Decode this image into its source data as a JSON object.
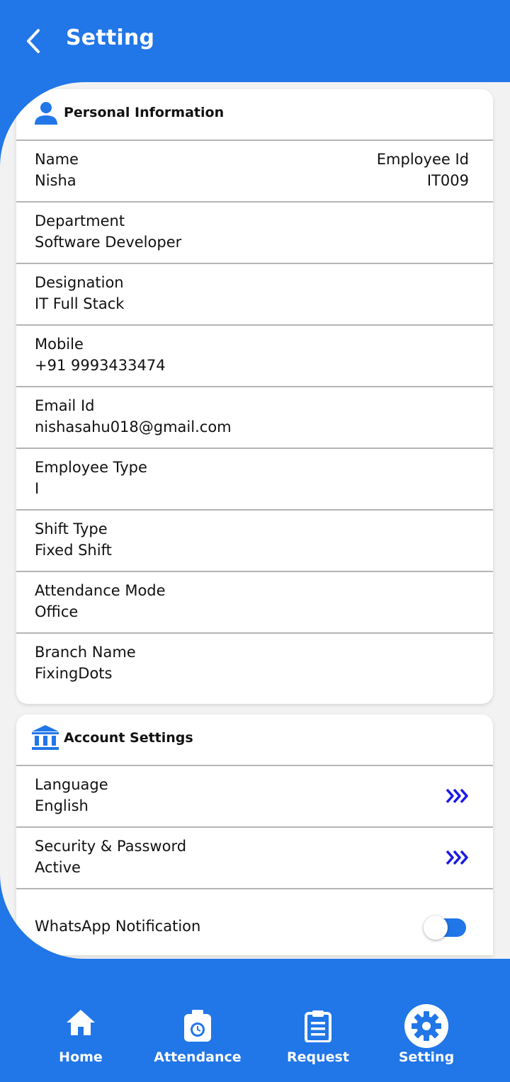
{
  "header": {
    "title": "Setting"
  },
  "personal": {
    "title": "Personal Information",
    "name_label": "Name",
    "name_value": "Nisha",
    "empid_label": "Employee Id",
    "empid_value": "IT009",
    "rows": [
      {
        "label": "Department",
        "value": "Software Developer"
      },
      {
        "label": "Designation",
        "value": "IT Full Stack"
      },
      {
        "label": "Mobile",
        "value": "+91 9993433474"
      },
      {
        "label": "Email Id",
        "value": "nishasahu018@gmail.com"
      },
      {
        "label": "Employee Type",
        "value": "I"
      },
      {
        "label": "Shift Type",
        "value": "Fixed Shift"
      },
      {
        "label": "Attendance Mode",
        "value": "Office"
      },
      {
        "label": "Branch Name",
        "value": "FixingDots"
      }
    ]
  },
  "account": {
    "title": "Account Settings",
    "rows": [
      {
        "label": "Language",
        "value": "English"
      },
      {
        "label": "Security & Password",
        "value": "Active"
      }
    ],
    "whatsapp_label": "WhatsApp Notification",
    "whatsapp_enabled": true
  },
  "nav": {
    "items": [
      {
        "label": "Home",
        "icon": "home-icon"
      },
      {
        "label": "Attendance",
        "icon": "attendance-icon"
      },
      {
        "label": "Request",
        "icon": "request-icon"
      },
      {
        "label": "Setting",
        "icon": "gear-icon",
        "active": true
      }
    ]
  },
  "colors": {
    "primary": "#2176E8",
    "chevron": "#1A1AE6",
    "background": "#F2F2F2"
  }
}
